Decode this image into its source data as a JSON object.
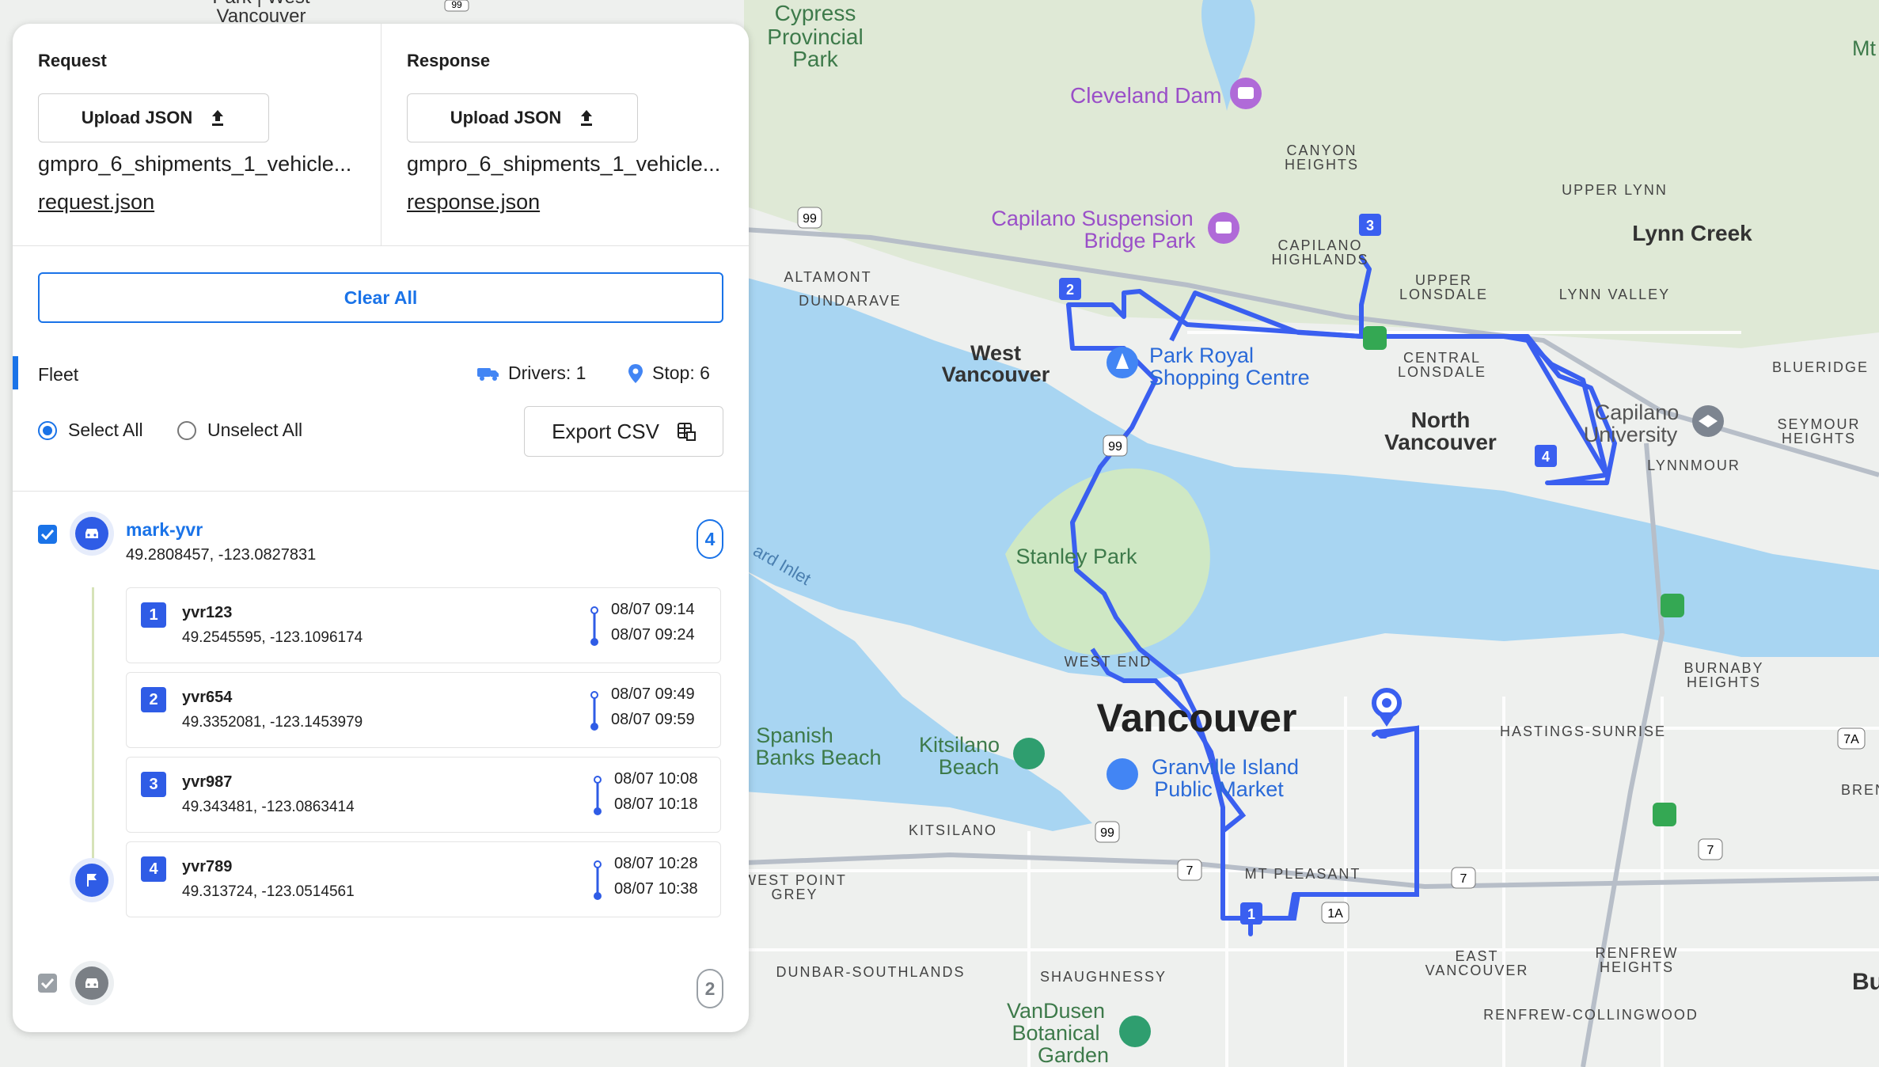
{
  "request": {
    "title": "Request",
    "upload_label": "Upload JSON",
    "file_name": "gmpro_6_shipments_1_vehicle...",
    "file_link": "request.json"
  },
  "response": {
    "title": "Response",
    "upload_label": "Upload JSON",
    "file_name": "gmpro_6_shipments_1_vehicle...",
    "file_link": "response.json"
  },
  "clear_all_label": "Clear All",
  "fleet": {
    "title": "Fleet",
    "drivers": "Drivers: 1",
    "stops": "Stop: 6",
    "select_all": "Select All",
    "unselect_all": "Unselect All",
    "export_label": "Export CSV"
  },
  "vehicles": [
    {
      "name": "mark-yvr",
      "coords": "49.2808457, -123.0827831",
      "count": "4",
      "stops": [
        {
          "num": "1",
          "id": "yvr123",
          "coords": "49.2545595, -123.1096174",
          "start": "08/07 09:14",
          "end": "08/07 09:24"
        },
        {
          "num": "2",
          "id": "yvr654",
          "coords": "49.3352081, -123.1453979",
          "start": "08/07 09:49",
          "end": "08/07 09:59"
        },
        {
          "num": "3",
          "id": "yvr987",
          "coords": "49.343481, -123.0863414",
          "start": "08/07 10:08",
          "end": "08/07 10:18"
        },
        {
          "num": "4",
          "id": "yvr789",
          "coords": "49.313724, -123.0514561",
          "start": "08/07 10:28",
          "end": "08/07 10:38"
        }
      ]
    },
    {
      "count": "2"
    }
  ],
  "map": {
    "labels": {
      "cypress": "Cypress",
      "provincial": "Provincial",
      "park": "Park",
      "cleveland_dam": "Cleveland Dam",
      "canyon": "CANYON",
      "heights": "HEIGHTS",
      "upper_lynn": "UPPER LYNN",
      "lynn_creek": "Lynn Creek",
      "capilano_susp": "Capilano Suspension",
      "bridge_park": "Bridge Park",
      "capilano": "CAPILANO",
      "highlands": "HIGHLANDS",
      "altamont": "ALTAMONT",
      "dundarave": "DUNDARAVE",
      "upper": "UPPER",
      "lonsdale": "LONSDALE",
      "lynn_valley": "LYNN VALLEY",
      "blueridge": "BLUERIDGE",
      "west": "West",
      "vancouver": "Vancouver",
      "park_royal": "Park Royal",
      "shopping_centre": "Shopping Centre",
      "central": "CENTRAL",
      "north": "North",
      "capilano_u1": "Capilano",
      "capilano_u2": "University",
      "seymour": "SEYMOUR",
      "lynnmour": "LYNNMOUR",
      "stanley_park": "Stanley Park",
      "burrard_inlet": "ard Inlet",
      "west_end": "WEST END",
      "burnaby": "BURNABY",
      "vancouver_big": "Vancouver",
      "hastings_sunrise": "HASTINGS-SUNRISE",
      "spanish": "Spanish",
      "banks_beach": "Banks Beach",
      "kitsilano_beach1": "Kitsilano",
      "kitsilano_beach2": "Beach",
      "granville1": "Granville Island",
      "granville2": "Public Market",
      "brentwood": "BRENTWO",
      "kitsilano": "KITSILANO",
      "west_point": "WEST POINT",
      "grey": "GREY",
      "mt_pleasant": "MT PLEASANT",
      "east": "EAST",
      "east_vancouver": "VANCOUVER",
      "renfrew": "RENFREW",
      "dunbar": "DUNBAR-SOUTHLANDS",
      "shaughnessy": "SHAUGHNESSY",
      "vandusen1": "VanDusen",
      "vandusen2": "Botanical",
      "vandusen3": "Garden",
      "renfrew_collingwood": "RENFREW-COLLINGWOOD",
      "mt_edge": "Mt",
      "bu_edge": "Bu",
      "west_vancouver_top": "Park | West",
      "vancouver_top": "Vancouver",
      "hw99": "99",
      "hw99b": "99",
      "hw99c": "99",
      "hw7": "7",
      "hw7b": "7",
      "hw7c": "7",
      "hw7a": "7A",
      "hw1a": "1A",
      "hw99top": "99",
      "m1": "1",
      "m2": "2",
      "m3": "3",
      "m4": "4"
    }
  }
}
